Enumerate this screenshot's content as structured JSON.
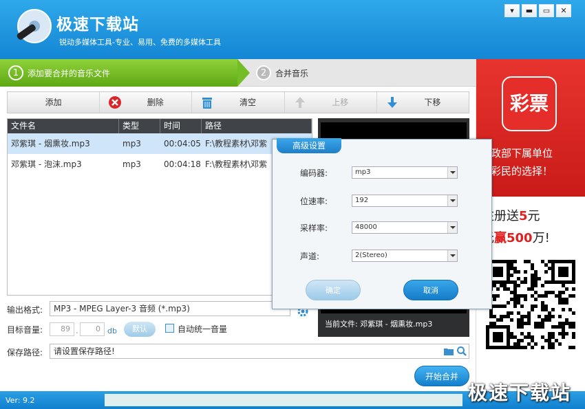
{
  "app": {
    "title": "极速下载站",
    "subtitle": "锐动多媒体工具-专业、易用、免费的多媒体工具",
    "win_controls": [
      "▾",
      "▬",
      "▭",
      "✕"
    ]
  },
  "steps": [
    {
      "num": "1",
      "label": "添加要合并的音乐文件"
    },
    {
      "num": "2",
      "label": "合并音乐"
    }
  ],
  "toolbar": {
    "add": "添加",
    "delete": "删除",
    "clear": "清空",
    "move_up": "上移",
    "move_down": "下移"
  },
  "filelist": {
    "headers": [
      "文件名",
      "类型",
      "时间",
      "路径"
    ],
    "rows": [
      [
        "邓紫琪 - 烟熏妆.mp3",
        "mp3",
        "00:04:05",
        "F:\\教程素材\\邓紫"
      ],
      [
        "邓紫琪 - 泡沫.mp3",
        "mp3",
        "00:04:18",
        "F:\\教程素材\\邓紫"
      ]
    ]
  },
  "preview": {
    "current_file": "当前文件: 邓紫琪 - 烟熏妆.mp3"
  },
  "output": {
    "format_label": "输出格式:",
    "format_value": "MP3 - MPEG Layer-3 音频 (*.mp3)",
    "volume_label": "目标音量:",
    "volume_int": "89",
    "volume_dot": ".",
    "volume_dec": "0",
    "volume_unit": "db",
    "default_btn": "默认",
    "auto_label": "自动统一音量",
    "path_label": "保存路径:",
    "path_value": "请设置保存路径!",
    "start_btn": "开始合并"
  },
  "status": {
    "version": "Ver: 9.2",
    "progress": 0,
    "watermark": "极速下载站"
  },
  "ad": {
    "logo": "彩票",
    "line1": "民政部下属单位",
    "line2": "亿彩民的选择！",
    "line3_pre": "注册送",
    "line3_num": "5",
    "line3_post": "元",
    "line4_pre": "元",
    "line4_mid": "赢",
    "line4_num": "500",
    "line4_post": "万!"
  },
  "dialog": {
    "title": "高级设置",
    "encoder_label": "编码器:",
    "encoder_value": "mp3",
    "bitrate_label": "位速率:",
    "bitrate_value": "192",
    "samplerate_label": "采样率:",
    "samplerate_value": "48000",
    "channel_label": "声道:",
    "channel_value": "2(Stereo)",
    "ok": "确定",
    "cancel": "取消"
  }
}
